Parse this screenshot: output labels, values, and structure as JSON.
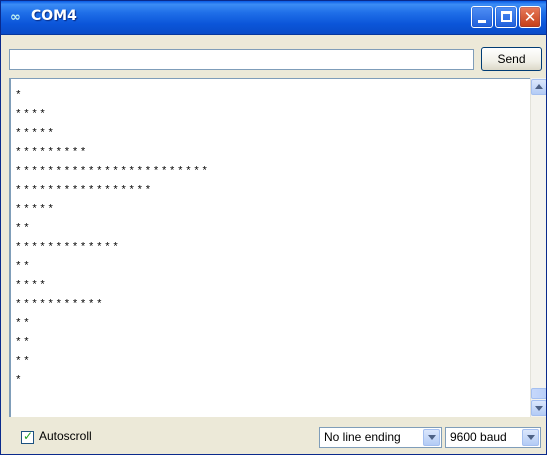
{
  "window": {
    "title": "COM4",
    "icon": "arduino-infinity-icon"
  },
  "input": {
    "value": ""
  },
  "toolbar": {
    "send_label": "Send"
  },
  "output": {
    "lines": [
      "******",
      "*",
      "****",
      "*****",
      "*********",
      "************************",
      "*****************",
      "*****",
      "**",
      "*************",
      "**",
      "****",
      "***********",
      "**",
      "**",
      "**",
      "*"
    ]
  },
  "status": {
    "autoscroll_label": "Autoscroll",
    "autoscroll_checked": true,
    "line_ending": "No line ending",
    "baud_rate": "9600 baud"
  },
  "colors": {
    "titlebar": "#0b55d9",
    "close_button": "#c33d16",
    "text_border": "#7f9db9"
  }
}
